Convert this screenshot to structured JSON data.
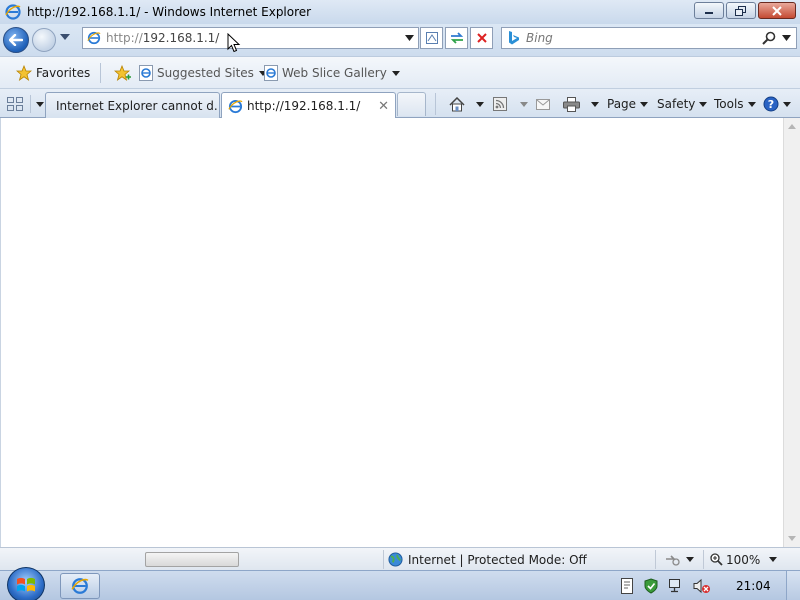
{
  "window": {
    "title": "http://192.168.1.1/ - Windows Internet Explorer",
    "controls": {
      "minimize": "minimize",
      "maximize": "maximize",
      "close": "close"
    }
  },
  "nav": {
    "address_prefix": "http://",
    "address_host": "192.168.1.1/",
    "search_placeholder": "Bing"
  },
  "favorites_bar": {
    "favorites_label": "Favorites",
    "items": [
      {
        "label": "Suggested Sites"
      },
      {
        "label": "Web Slice Gallery"
      }
    ]
  },
  "tabs": [
    {
      "label": "Internet Explorer cannot d...",
      "active": false
    },
    {
      "label": "http://192.168.1.1/",
      "active": true
    }
  ],
  "commands": {
    "page": "Page",
    "safety": "Safety",
    "tools": "Tools"
  },
  "statusbar": {
    "zone": "Internet | Protected Mode: Off",
    "zoom": "100%"
  },
  "taskbar": {
    "clock": "21:04"
  },
  "colors": {
    "accent": "#1d5fb8",
    "ie_blue": "#2a7ad6",
    "close_red": "#c44a32"
  },
  "icons": {
    "app": "ie-icon",
    "back": "back-arrow-icon",
    "forward": "forward-arrow-icon",
    "compat": "compatibility-view-icon",
    "refresh": "refresh-icon",
    "stop": "stop-icon",
    "search": "search-icon",
    "favorites": "star-icon",
    "home": "home-icon",
    "feeds": "rss-icon",
    "mail": "mail-icon",
    "print": "printer-icon",
    "help": "help-icon",
    "globe": "globe-icon"
  }
}
